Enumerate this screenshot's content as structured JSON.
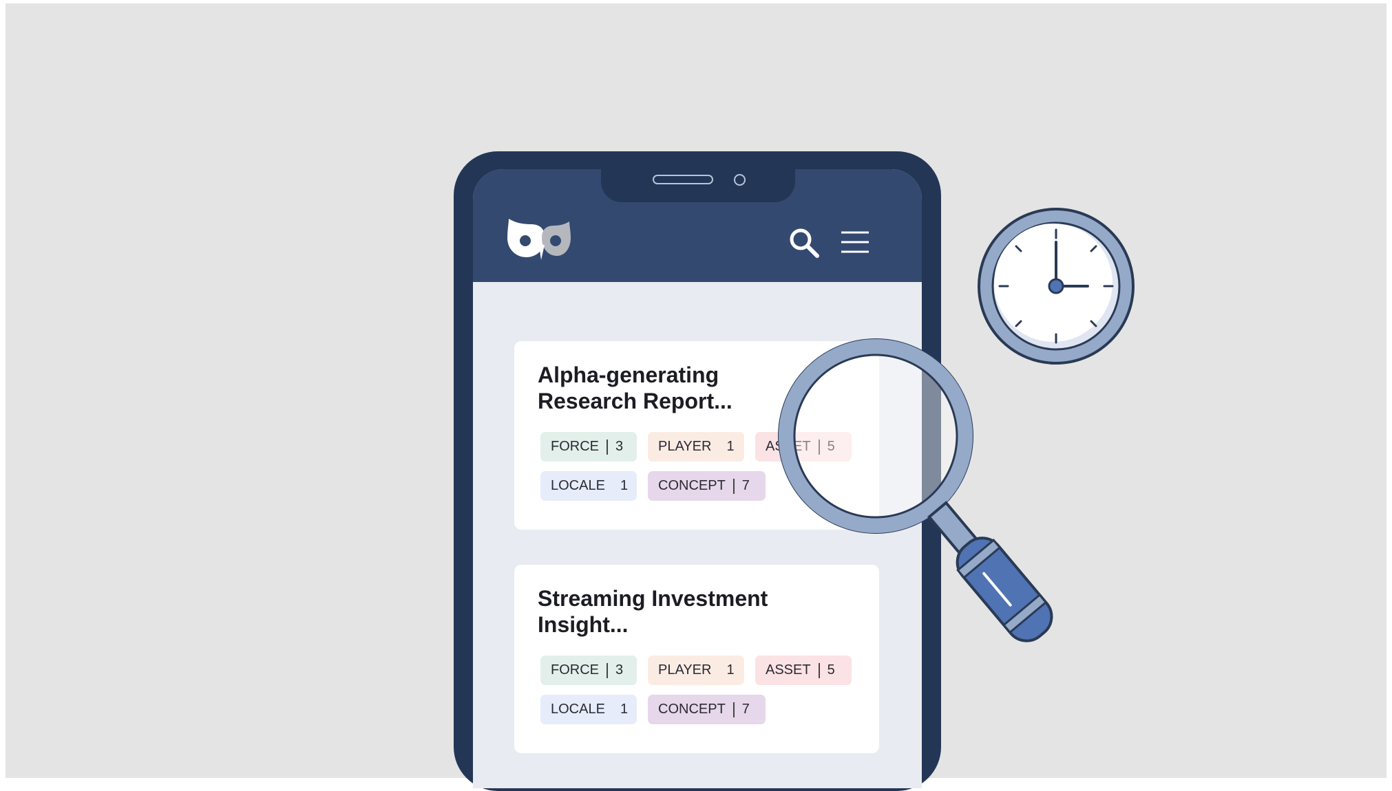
{
  "colors": {
    "background": "#e4e4e4",
    "phone_frame": "#243656",
    "app_header": "#334970",
    "screen": "#e8ebf1",
    "tag_force": "#e3efea",
    "tag_player": "#fbece3",
    "tag_asset": "#fbe2e4",
    "tag_locale": "#e6ecfa",
    "tag_concept": "#e6d7ea",
    "magnifier_ring": "#95a9c9",
    "magnifier_handle": "#4f73b3"
  },
  "header": {
    "logo_icon": "owl-logo-icon",
    "search_icon": "search-icon",
    "menu_icon": "hamburger-menu-icon"
  },
  "cards": [
    {
      "title": "Alpha-generating\nResearch Report...",
      "tags": [
        {
          "label": "FORCE",
          "count": "3"
        },
        {
          "label": "PLAYER",
          "count": "1"
        },
        {
          "label": "ASSET",
          "count": "5"
        },
        {
          "label": "LOCALE",
          "count": "1"
        },
        {
          "label": "CONCEPT",
          "count": "7"
        }
      ]
    },
    {
      "title": "Streaming Investment\nInsight...",
      "tags": [
        {
          "label": "FORCE",
          "count": "3"
        },
        {
          "label": "PLAYER",
          "count": "1"
        },
        {
          "label": "ASSET",
          "count": "5"
        },
        {
          "label": "LOCALE",
          "count": "1"
        },
        {
          "label": "CONCEPT",
          "count": "7"
        }
      ]
    }
  ],
  "decor": {
    "clock_icon": "clock-icon",
    "magnifier_icon": "magnifying-glass-icon"
  }
}
